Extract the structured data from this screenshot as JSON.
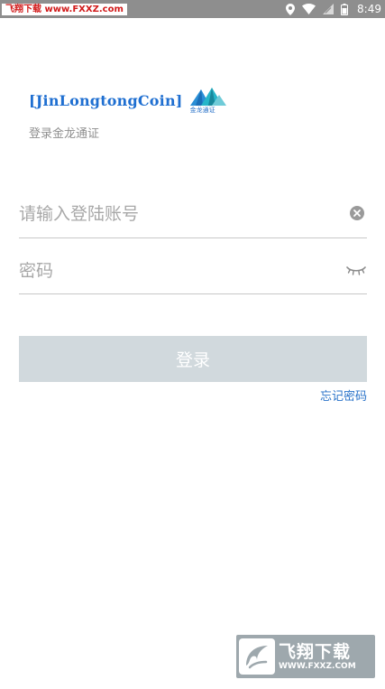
{
  "status_bar": {
    "watermark": "飞翔下载 www.FXXZ.com",
    "time": "8:49"
  },
  "logo": {
    "brand": "[JinLongtongCoin]",
    "mark_text": "金龙通证"
  },
  "app_subtitle": "登录金龙通证",
  "form": {
    "account_placeholder": "请输入登陆账号",
    "password_placeholder": "密码"
  },
  "login_button_label": "登录",
  "forgot_password_label": "忘记密码",
  "watermark_bottom": {
    "title": "飞翔下载",
    "url": "WWW.FXXZ.COM"
  },
  "colors": {
    "brand_blue": "#1f6fd1",
    "button_disabled": "#d1d9dd",
    "status_bar": "#8e8e8e"
  },
  "icons": {
    "clear": "clear-icon",
    "password_visibility": "eye-closed-icon"
  }
}
